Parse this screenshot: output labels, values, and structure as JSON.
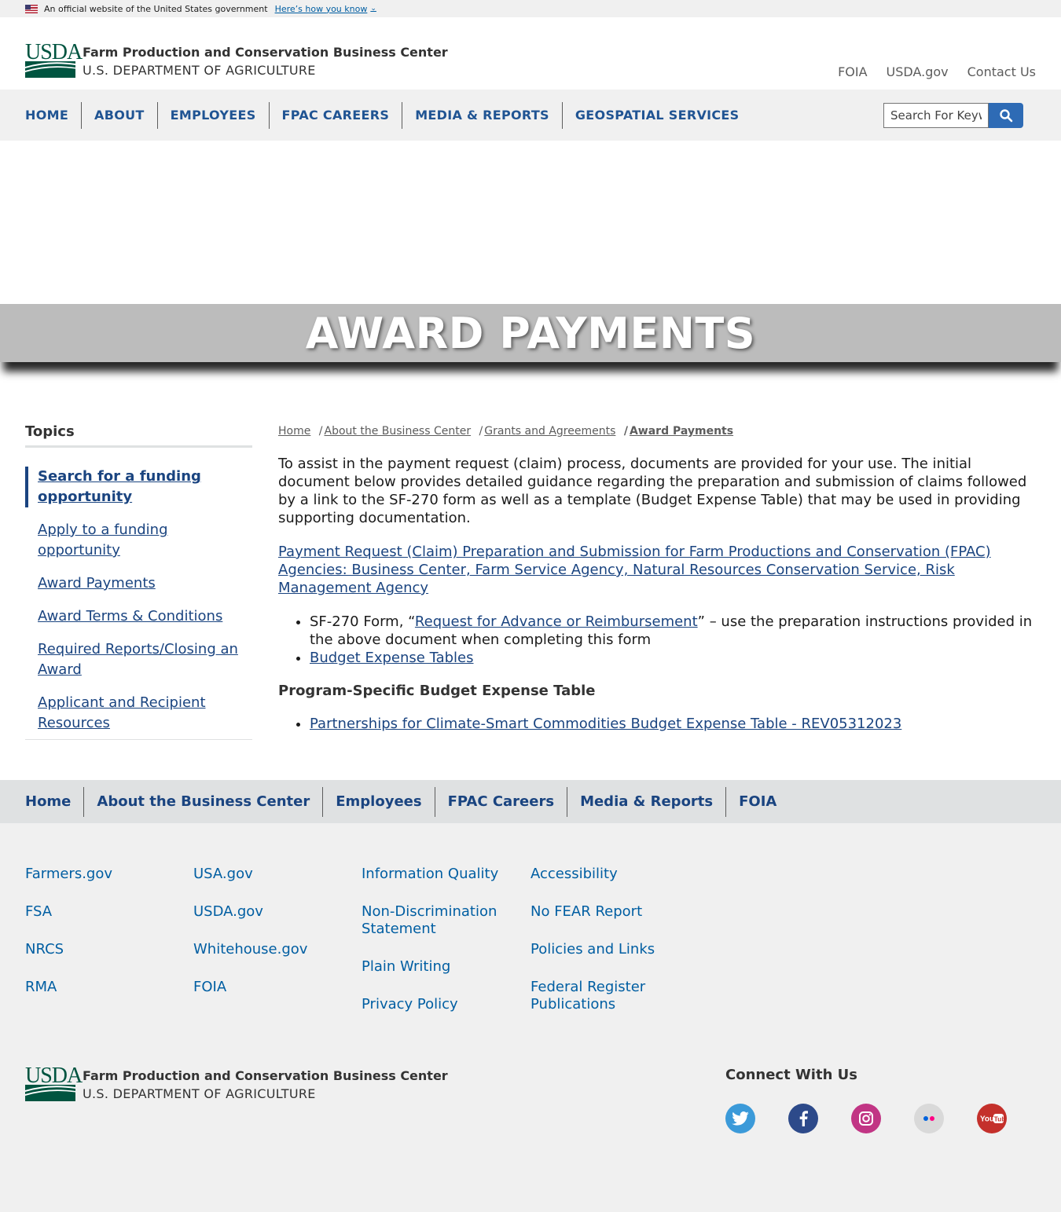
{
  "gov_banner": {
    "text": "An official website of the United States government",
    "link": "Here’s how you know"
  },
  "header": {
    "logo_mark": "USDA",
    "org_name": "Farm Production and Conservation Business Center",
    "dept_name": "U.S. DEPARTMENT OF AGRICULTURE",
    "utility_links": [
      "FOIA",
      "USDA.gov",
      "Contact Us"
    ]
  },
  "nav": {
    "items": [
      "HOME",
      "ABOUT",
      "EMPLOYEES",
      "FPAC CAREERS",
      "MEDIA & REPORTS",
      "GEOSPATIAL SERVICES"
    ],
    "search_placeholder": "Search For Keyw"
  },
  "hero": {
    "title": "AWARD PAYMENTS"
  },
  "sidebar": {
    "heading": "Topics",
    "items": [
      {
        "label": "Search for a funding opportunity",
        "active": true
      },
      {
        "label": "Apply to a funding opportunity",
        "active": false
      },
      {
        "label": "Award Payments",
        "active": false
      },
      {
        "label": "Award Terms & Conditions",
        "active": false
      },
      {
        "label": "Required Reports/Closing an Award",
        "active": false
      },
      {
        "label": "Applicant and Recipient Resources",
        "active": false
      }
    ]
  },
  "breadcrumb": {
    "items": [
      "Home",
      "About the Business Center",
      "Grants and Agreements"
    ],
    "current": "Award Payments"
  },
  "main": {
    "intro": "To assist in the payment request (claim) process, documents are provided for your use. The initial document below provides detailed guidance regarding the preparation and submission of claims followed by a link to the SF-270 form as well as a template (Budget Expense Table) that may be used in providing supporting documentation.",
    "doc_link": "Payment Request (Claim) Preparation and Submission for Farm Productions and Conservation (FPAC) Agencies: Business Center, Farm Service Agency, Natural Resources Conservation Service, Risk Management Agency",
    "bullet1_prefix": "SF-270 Form, “",
    "bullet1_link": "Request for Advance or Reimbursement",
    "bullet1_suffix": "” – use the preparation instructions provided in the above document when completing this form",
    "bullet2_link": "Budget Expense Tables",
    "subheading": "Program-Specific Budget Expense Table",
    "bullet3_link": "Partnerships for Climate-Smart Commodities Budget Expense Table - REV05312023"
  },
  "footer_nav": {
    "items": [
      "Home",
      "About the Business Center",
      "Employees",
      "FPAC Careers",
      "Media & Reports",
      "FOIA"
    ]
  },
  "footer_links": {
    "col1": [
      "Farmers.gov",
      "FSA",
      "NRCS",
      "RMA"
    ],
    "col2": [
      "USA.gov",
      "USDA.gov",
      "Whitehouse.gov",
      "FOIA"
    ],
    "col3": [
      "Information Quality",
      "Non-Discrimination Statement",
      "Plain Writing",
      "Privacy Policy"
    ],
    "col4": [
      "Accessibility",
      "No FEAR Report",
      "Policies and Links",
      "Federal Register Publications"
    ]
  },
  "footer_bottom": {
    "connect_heading": "Connect With Us",
    "socials": [
      {
        "icon": "twitter-icon",
        "color": "#3b9ad9"
      },
      {
        "icon": "facebook-icon",
        "color": "#2d4a8a"
      },
      {
        "icon": "instagram-icon",
        "color": "#c13584"
      },
      {
        "icon": "flickr-icon",
        "color": "#d9d9d9"
      },
      {
        "icon": "youtube-icon",
        "color": "#c4302b"
      }
    ]
  },
  "colors": {
    "link": "#1a4480",
    "nav_link": "#205493",
    "usda_green": "#005440",
    "search_button": "#2e6bb5",
    "hero_band": "#bcbcbc"
  }
}
